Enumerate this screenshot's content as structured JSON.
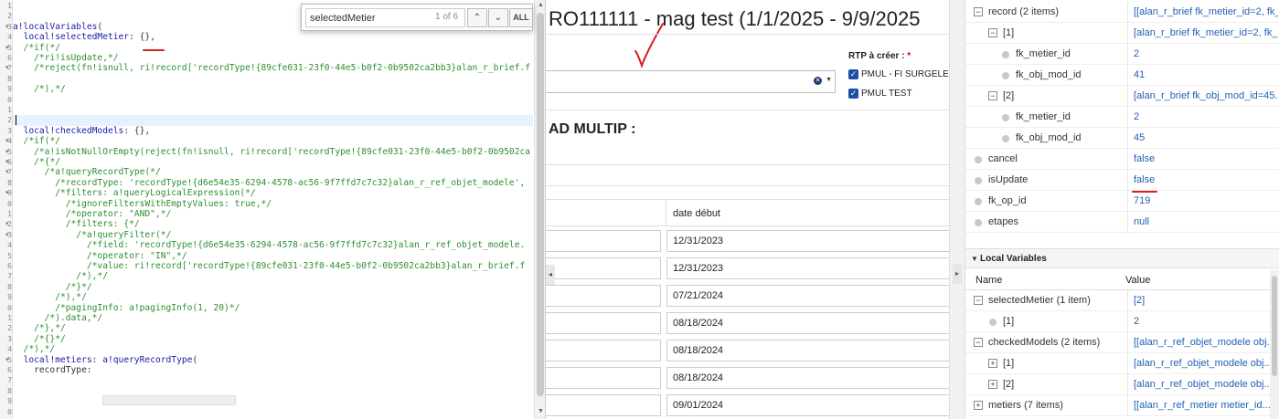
{
  "editor": {
    "lines": [
      {
        "n": "1",
        "fold": "",
        "parts": [
          [
            "pl",
            ""
          ]
        ]
      },
      {
        "n": "2",
        "fold": "",
        "parts": [
          [
            "pl",
            ""
          ]
        ]
      },
      {
        "n": "3",
        "fold": "▾",
        "parts": [
          [
            "kw",
            "a!localVariables"
          ],
          [
            "pl",
            "("
          ]
        ]
      },
      {
        "n": "4",
        "fold": "",
        "parts": [
          [
            "pl",
            "  "
          ],
          [
            "kw",
            "local!selectedMetier"
          ],
          [
            "pl",
            ": {},"
          ]
        ]
      },
      {
        "n": "5",
        "fold": "▾",
        "parts": [
          [
            "cm",
            "  /*if(*/"
          ]
        ]
      },
      {
        "n": "6",
        "fold": "",
        "parts": [
          [
            "cm",
            "    /*ri!isUpdate,*/"
          ]
        ]
      },
      {
        "n": "7",
        "fold": "▾",
        "parts": [
          [
            "cm",
            "    /*reject(fn!isnull, ri!record['recordType!{89cfe031-23f0-44e5-b0f2-0b9502ca2bb3}alan_r_brief.f"
          ]
        ]
      },
      {
        "n": "8",
        "fold": "",
        "parts": [
          [
            "pl",
            ""
          ]
        ]
      },
      {
        "n": "9",
        "fold": "",
        "parts": [
          [
            "cm",
            "    /*),*/"
          ]
        ]
      },
      {
        "n": "0",
        "fold": "",
        "parts": [
          [
            "pl",
            ""
          ]
        ]
      },
      {
        "n": "1",
        "fold": "",
        "parts": [
          [
            "pl",
            ""
          ]
        ]
      },
      {
        "n": "2",
        "fold": "",
        "parts": [
          [
            "pl",
            ""
          ]
        ]
      },
      {
        "n": "3",
        "fold": "",
        "parts": [
          [
            "pl",
            "  "
          ],
          [
            "kw",
            "local!checkedModels"
          ],
          [
            "pl",
            ": {},"
          ]
        ]
      },
      {
        "n": "4",
        "fold": "▾",
        "parts": [
          [
            "cm",
            "  /*if(*/"
          ]
        ]
      },
      {
        "n": "5",
        "fold": "▾",
        "parts": [
          [
            "cm",
            "    /*a!isNotNullOrEmpty(reject(fn!isnull, ri!record['recordType!{89cfe031-23f0-44e5-b0f2-0b9502ca"
          ]
        ]
      },
      {
        "n": "6",
        "fold": "▾",
        "parts": [
          [
            "cm",
            "    /*{*/"
          ]
        ]
      },
      {
        "n": "7",
        "fold": "▾",
        "parts": [
          [
            "cm",
            "      /*a!queryRecordType(*/"
          ]
        ]
      },
      {
        "n": "8",
        "fold": "",
        "parts": [
          [
            "cm",
            "        /*recordType: 'recordType!{d6e54e35-6294-4578-ac56-9f7ffd7c7c32}alan_r_ref_objet_modele',"
          ]
        ]
      },
      {
        "n": "9",
        "fold": "▾",
        "parts": [
          [
            "cm",
            "        /*filters: a!queryLogicalExpression(*/"
          ]
        ]
      },
      {
        "n": "0",
        "fold": "",
        "parts": [
          [
            "cm",
            "          /*ignoreFiltersWithEmptyValues: true,*/"
          ]
        ]
      },
      {
        "n": "1",
        "fold": "",
        "parts": [
          [
            "cm",
            "          /*operator: \"AND\",*/"
          ]
        ]
      },
      {
        "n": "2",
        "fold": "▾",
        "parts": [
          [
            "cm",
            "          /*filters: {*/"
          ]
        ]
      },
      {
        "n": "3",
        "fold": "▾",
        "parts": [
          [
            "cm",
            "            /*a!queryFilter(*/"
          ]
        ]
      },
      {
        "n": "4",
        "fold": "",
        "parts": [
          [
            "cm",
            "              /*field: 'recordType!{d6e54e35-6294-4578-ac56-9f7ffd7c7c32}alan_r_ref_objet_modele."
          ]
        ]
      },
      {
        "n": "5",
        "fold": "",
        "parts": [
          [
            "cm",
            "              /*operator: \"IN\",*/"
          ]
        ]
      },
      {
        "n": "6",
        "fold": "",
        "parts": [
          [
            "cm",
            "              /*value: ri!record['recordType!{89cfe031-23f0-44e5-b0f2-0b9502ca2bb3}alan_r_brief.f"
          ]
        ]
      },
      {
        "n": "7",
        "fold": "",
        "parts": [
          [
            "cm",
            "            /*),*/"
          ]
        ]
      },
      {
        "n": "8",
        "fold": "",
        "parts": [
          [
            "cm",
            "          /*}*/"
          ]
        ]
      },
      {
        "n": "9",
        "fold": "",
        "parts": [
          [
            "cm",
            "        /*),*/"
          ]
        ]
      },
      {
        "n": "0",
        "fold": "",
        "parts": [
          [
            "cm",
            "        /*pagingInfo: a!pagingInfo(1, 20)*/"
          ]
        ]
      },
      {
        "n": "1",
        "fold": "",
        "parts": [
          [
            "cm",
            "      /*).data,*/"
          ]
        ]
      },
      {
        "n": "2",
        "fold": "",
        "parts": [
          [
            "cm",
            "    /*},*/"
          ]
        ]
      },
      {
        "n": "3",
        "fold": "",
        "parts": [
          [
            "cm",
            "    /*{}*/"
          ]
        ]
      },
      {
        "n": "4",
        "fold": "",
        "parts": [
          [
            "cm",
            "  /*),*/"
          ]
        ]
      },
      {
        "n": "5",
        "fold": "▾",
        "parts": [
          [
            "pl",
            "  "
          ],
          [
            "kw",
            "local!metiers"
          ],
          [
            "pl",
            ": "
          ],
          [
            "kw",
            "a!queryRecordType"
          ],
          [
            "pl",
            "("
          ]
        ]
      },
      {
        "n": "6",
        "fold": "",
        "parts": [
          [
            "pl",
            "    recordType: "
          ]
        ]
      },
      {
        "n": "7",
        "fold": "",
        "parts": [
          [
            "pl",
            ""
          ]
        ]
      },
      {
        "n": "8",
        "fold": "",
        "parts": [
          [
            "pl",
            ""
          ]
        ]
      },
      {
        "n": "9",
        "fold": "",
        "parts": [
          [
            "pl",
            ""
          ]
        ]
      },
      {
        "n": "0",
        "fold": "",
        "parts": [
          [
            "pl",
            ""
          ]
        ]
      }
    ]
  },
  "find": {
    "query": "selectedMetier",
    "count": "1 of 6",
    "prev_icon": "⌃",
    "next_icon": "⌄",
    "all_label": "ALL"
  },
  "form": {
    "title": "RO111111 - mag test (1/1/2025 - 9/9/2025",
    "rtp_label": "RTP à créer :",
    "rtp_required": "*",
    "checkboxes": [
      "PMUL - FI SURGELE",
      "PMUL TEST"
    ],
    "section_title": "AD MULTIP :",
    "col_date": "date début",
    "dates": [
      "12/31/2023",
      "12/31/2023",
      "07/21/2024",
      "08/18/2024",
      "08/18/2024",
      "08/18/2024",
      "09/01/2024"
    ],
    "collapse_icon": "◂"
  },
  "rule_inputs": {
    "rows": [
      {
        "level": 0,
        "box": "⊟",
        "name": "record (2 items)",
        "value": "[[alan_r_brief fk_metier_id=2, fk_obj_mod_id=41"
      },
      {
        "level": 1,
        "box": "⊟",
        "name": "[1]",
        "value": "[alan_r_brief fk_metier_id=2, fk_obj_mod_id=41"
      },
      {
        "level": 2,
        "box": "",
        "name": "fk_metier_id",
        "value": "2"
      },
      {
        "level": 2,
        "box": "",
        "name": "fk_obj_mod_id",
        "value": "41"
      },
      {
        "level": 1,
        "box": "⊟",
        "name": "[2]",
        "value": "[alan_r_brief fk_obj_mod_id=45..."
      },
      {
        "level": 2,
        "box": "",
        "name": "fk_metier_id",
        "value": "2"
      },
      {
        "level": 2,
        "box": "",
        "name": "fk_obj_mod_id",
        "value": "45"
      },
      {
        "level": 0,
        "box": "",
        "name": "cancel",
        "value": "false"
      },
      {
        "level": 0,
        "box": "",
        "name": "isUpdate",
        "value": "false"
      },
      {
        "level": 0,
        "box": "",
        "name": "fk_op_id",
        "value": "719"
      },
      {
        "level": 0,
        "box": "",
        "name": "etapes",
        "value": "null"
      }
    ]
  },
  "local_variables": {
    "title": "Local Variables",
    "col_name": "Name",
    "col_value": "Value",
    "rows": [
      {
        "level": 0,
        "box": "⊟",
        "name": "selectedMetier (1 item)",
        "value": "[2]"
      },
      {
        "level": 1,
        "box": "",
        "name": "[1]",
        "value": "2"
      },
      {
        "level": 0,
        "box": "⊟",
        "name": "checkedModels (2 items)",
        "value": "[[alan_r_ref_objet_modele obj..."
      },
      {
        "level": 1,
        "box": "⊞",
        "name": "[1]",
        "value": "[alan_r_ref_objet_modele obj..."
      },
      {
        "level": 1,
        "box": "⊞",
        "name": "[2]",
        "value": "[alan_r_ref_objet_modele obj..."
      },
      {
        "level": 0,
        "box": "⊞",
        "name": "metiers (7 items)",
        "value": "[[alan_r_ref_metier metier_id..."
      }
    ]
  },
  "colors": {
    "keyword": "#1a1aa6",
    "comment": "#2f8f2f",
    "link_value": "#2360b5",
    "annotation_red": "#d62020",
    "checkbox": "#1e4fa0"
  }
}
